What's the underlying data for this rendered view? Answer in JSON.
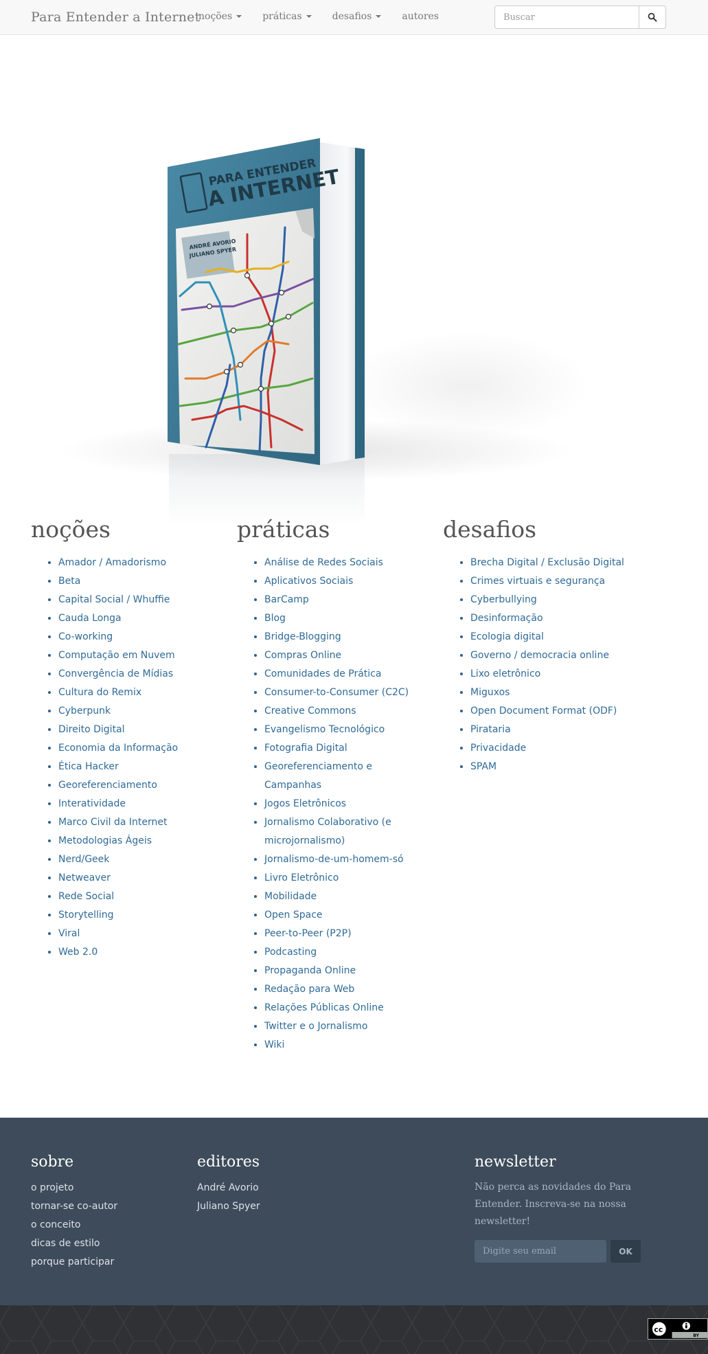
{
  "navbar": {
    "brand": "Para Entender a Internet",
    "items": [
      {
        "label": "noções",
        "dropdown": true
      },
      {
        "label": "práticas",
        "dropdown": true
      },
      {
        "label": "desafios",
        "dropdown": true
      },
      {
        "label": "autores",
        "dropdown": false
      }
    ],
    "search_placeholder": "Buscar"
  },
  "hero": {
    "book_title_line1": "PARA ENTENDER",
    "book_title_line2": "A INTERNET",
    "book_authors_line1": "ANDRÉ AVORIO",
    "book_authors_line2": "JULIANO SPYER"
  },
  "columns": {
    "nocoes": {
      "title": "noções",
      "items": [
        "Amador / Amadorismo",
        "Beta",
        "Capital Social / Whuffie",
        "Cauda Longa",
        "Co-working",
        "Computação em Nuvem",
        "Convergência de Mídias",
        "Cultura do Remix",
        "Cyberpunk",
        "Direito Digital",
        "Economia da Informação",
        "Ética Hacker",
        "Georeferenciamento",
        "Interatividade",
        "Marco Civil da Internet",
        "Metodologias Ágeis",
        "Nerd/Geek",
        "Netweaver",
        "Rede Social",
        "Storytelling",
        "Viral",
        "Web 2.0"
      ]
    },
    "praticas": {
      "title": "práticas",
      "items": [
        "Análise de Redes Sociais",
        "Aplicativos Sociais",
        "BarCamp",
        "Blog",
        "Bridge-Blogging",
        "Compras Online",
        "Comunidades de Prática",
        "Consumer-to-Consumer (C2C)",
        "Creative Commons",
        "Evangelismo Tecnológico",
        "Fotografia Digital",
        "Georeferenciamento e Campanhas",
        "Jogos Eletrônicos",
        "Jornalismo Colaborativo (e microjornalismo)",
        "Jornalismo-de-um-homem-só",
        "Livro Eletrônico",
        "Mobilidade",
        "Open Space",
        "Peer-to-Peer (P2P)",
        "Podcasting",
        "Propaganda Online",
        "Redação para Web",
        "Relações Públicas Online",
        "Twitter e o Jornalismo",
        "Wiki"
      ]
    },
    "desafios": {
      "title": "desafios",
      "items": [
        "Brecha Digital / Exclusão Digital",
        "Crimes virtuais e segurança",
        "Cyberbullying",
        "Desinformação",
        "Ecologia digital",
        "Governo / democracia online",
        "Lixo eletrônico",
        "Miguxos",
        "Open Document Format (ODF)",
        "Pirataria",
        "Privacidade",
        "SPAM"
      ]
    }
  },
  "footer": {
    "sobre": {
      "title": "sobre",
      "links": [
        "o projeto",
        "tornar-se co-autor",
        "o conceito",
        "dicas de estilo",
        "porque participar"
      ]
    },
    "editores": {
      "title": "editores",
      "links": [
        "André Avorio",
        "Juliano Spyer"
      ]
    },
    "newsletter": {
      "title": "newsletter",
      "text": "Não perca as novidades do Para Entender. Inscreva-se na nossa newsletter!",
      "placeholder": "Digite seu email",
      "button": "OK"
    }
  },
  "license": {
    "badge": "CC BY",
    "short": "BY"
  },
  "colors": {
    "link": "#2f5f88",
    "footer_bg": "#3d4b5a",
    "bottom_bg": "#2f3135",
    "book_teal": "#3f7a94"
  }
}
